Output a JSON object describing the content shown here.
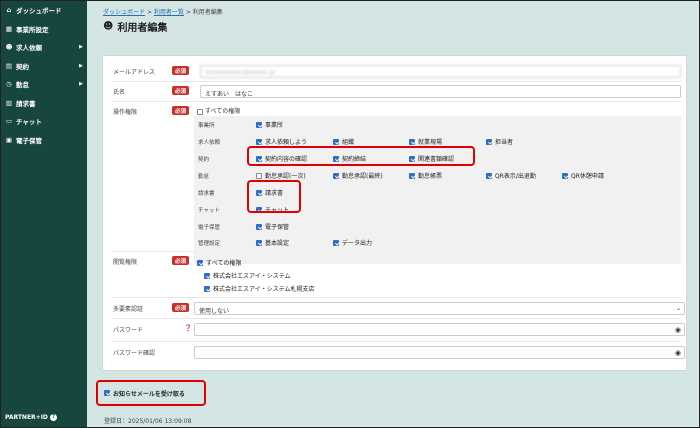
{
  "sidebar": {
    "items": [
      {
        "icon": "home-icon",
        "label": "ダッシュボード",
        "arrow": ""
      },
      {
        "icon": "building-icon",
        "label": "事業所設定",
        "arrow": ""
      },
      {
        "icon": "people-icon",
        "label": "求人依頼",
        "arrow": "▶"
      },
      {
        "icon": "document-icon",
        "label": "契約",
        "arrow": "▶"
      },
      {
        "icon": "clock-icon",
        "label": "勤怠",
        "arrow": "▶"
      },
      {
        "icon": "invoice-icon",
        "label": "請求書",
        "arrow": ""
      },
      {
        "icon": "chat-icon",
        "label": "チャット",
        "arrow": ""
      },
      {
        "icon": "storage-icon",
        "label": "電子保管",
        "arrow": ""
      }
    ],
    "footer": "PARTNER+ID"
  },
  "breadcrumb": {
    "item1": "ダッシュボード",
    "sep": ">",
    "item2": "利用者一覧",
    "item3": "利用者編集"
  },
  "page_title": "利用者編集",
  "form": {
    "required": "必須",
    "email": {
      "label": "メールアドレス",
      "value": "xxxxxxxxxxx@xxxxx.jp"
    },
    "name": {
      "label": "氏名",
      "value": "えすあい　はなこ"
    },
    "permissions": {
      "label": "操作権限",
      "all_label": "すべての権限",
      "rows": [
        {
          "label": "事業所",
          "options": [
            {
              "label": "事業所",
              "checked": true
            }
          ]
        },
        {
          "label": "求人依頼",
          "options": [
            {
              "label": "求人依頼しよう",
              "checked": true
            },
            {
              "label": "組織",
              "checked": true
            },
            {
              "label": "就業現場",
              "checked": true
            },
            {
              "label": "担当者",
              "checked": true
            }
          ]
        },
        {
          "label": "契約",
          "options": [
            {
              "label": "契約内容の確認",
              "checked": true
            },
            {
              "label": "契約締結",
              "checked": true
            },
            {
              "label": "関連書類確認",
              "checked": true
            }
          ]
        },
        {
          "label": "勤怠",
          "options": [
            {
              "label": "勤怠承認(一次)",
              "checked": false
            },
            {
              "label": "勤怠承認(最終)",
              "checked": true
            },
            {
              "label": "勤怠帳票",
              "checked": true
            },
            {
              "label": "QR表示/出退勤",
              "checked": true
            },
            {
              "label": "QR休憩申請",
              "checked": true
            }
          ]
        },
        {
          "label": "請求書",
          "options": [
            {
              "label": "請求書",
              "checked": true
            }
          ]
        },
        {
          "label": "チャット",
          "options": [
            {
              "label": "チャット",
              "checked": true
            }
          ]
        },
        {
          "label": "電子保管",
          "options": [
            {
              "label": "電子保管",
              "checked": true
            }
          ]
        },
        {
          "label": "管理設定",
          "options": [
            {
              "label": "基本設定",
              "checked": true
            },
            {
              "label": "データ出力",
              "checked": true
            }
          ]
        }
      ]
    },
    "view": {
      "label": "閲覧権限",
      "options": [
        {
          "label": "すべての権限",
          "checked": true
        },
        {
          "label": "株式会社エスアイ・システム",
          "checked": true
        },
        {
          "label": "株式会社エスアイ・システム札幌支店",
          "checked": true
        }
      ]
    },
    "mfa": {
      "label": "多要素認証",
      "value": "使用しない"
    },
    "password": {
      "label": "パスワード",
      "help_icon": "question-icon"
    },
    "password_confirm": {
      "label": "パスワード確認"
    },
    "notify": {
      "label": "お知らせメールを受け取る",
      "checked": true
    }
  },
  "registered": "登録日：2025/01/06 13:09:08",
  "colors": {
    "sidebar": "#17463f",
    "background": "#d4e6e4",
    "required": "#c9302c",
    "checkbox": "#2f6fc2",
    "highlight": "#e00000"
  }
}
